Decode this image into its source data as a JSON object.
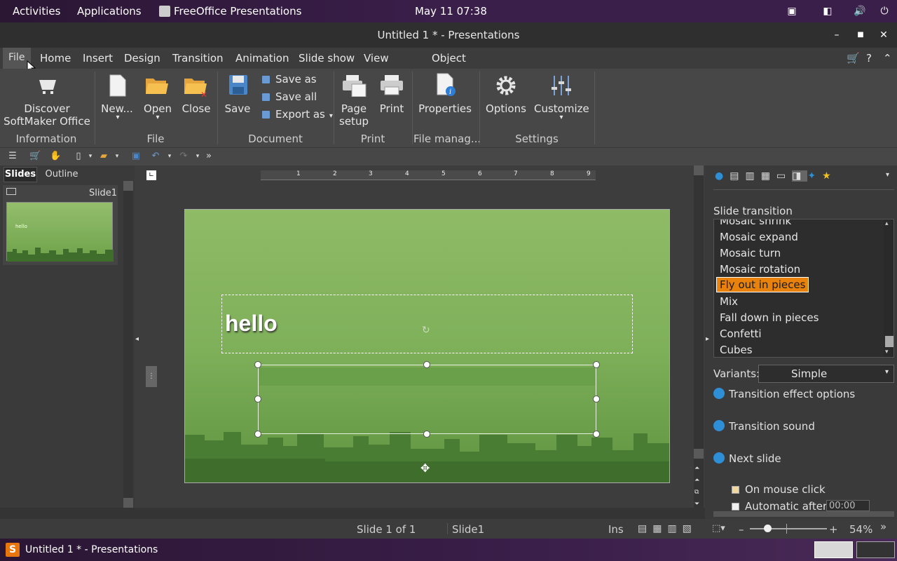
{
  "topbar": {
    "activities": "Activities",
    "applications": "Applications",
    "app_name": "FreeOffice Presentations",
    "clock": "May 11  07:38"
  },
  "window": {
    "title": "Untitled 1 * - Presentations"
  },
  "menu": {
    "items": [
      "File",
      "Home",
      "Insert",
      "Design",
      "Transition",
      "Animation",
      "Slide show",
      "View",
      "Object"
    ]
  },
  "ribbon": {
    "discover_line1": "Discover",
    "discover_line2": "SoftMaker Office",
    "new": "New...",
    "open": "Open",
    "close": "Close",
    "save": "Save",
    "save_as": "Save as",
    "save_all": "Save all",
    "export_as": "Export as",
    "page_setup_line1": "Page",
    "page_setup_line2": "setup",
    "print": "Print",
    "properties": "Properties",
    "options": "Options",
    "customize": "Customize",
    "groups": {
      "information": "Information",
      "file": "File",
      "document": "Document",
      "print": "Print",
      "file_manager": "File manag...",
      "settings": "Settings"
    }
  },
  "left_pane": {
    "tab_slides": "Slides",
    "tab_outline": "Outline",
    "slide_label": "Slide1",
    "thumb_text": "hello"
  },
  "slide": {
    "title": "hello"
  },
  "ruler": {
    "ticks": [
      "1",
      "2",
      "3",
      "4",
      "5",
      "6",
      "7",
      "8",
      "9"
    ]
  },
  "right_pane": {
    "heading": "Slide transition",
    "transitions": [
      "Mosaic shrink",
      "Mosaic expand",
      "Mosaic turn",
      "Mosaic rotation",
      "Fly out in pieces",
      "Mix",
      "Fall down in pieces",
      "Confetti",
      "Cubes"
    ],
    "selected_transition": "Fly out in pieces",
    "variants_label": "Variants:",
    "variants_value": "Simple",
    "section_effect": "Transition effect options",
    "section_sound": "Transition sound",
    "section_next": "Next slide",
    "on_mouse_click": "On mouse click",
    "automatic_after": "Automatic after:",
    "automatic_value": "00:00"
  },
  "status": {
    "slide_count": "Slide 1 of 1",
    "slide_name": "Slide1",
    "mode": "Ins",
    "zoom": "54%"
  },
  "taskbar": {
    "item": "Untitled 1 * - Presentations"
  },
  "colors": {
    "accent_selected": "#e8820c",
    "info_blue": "#2e8fd6",
    "slide_green": "#7fb05a"
  }
}
